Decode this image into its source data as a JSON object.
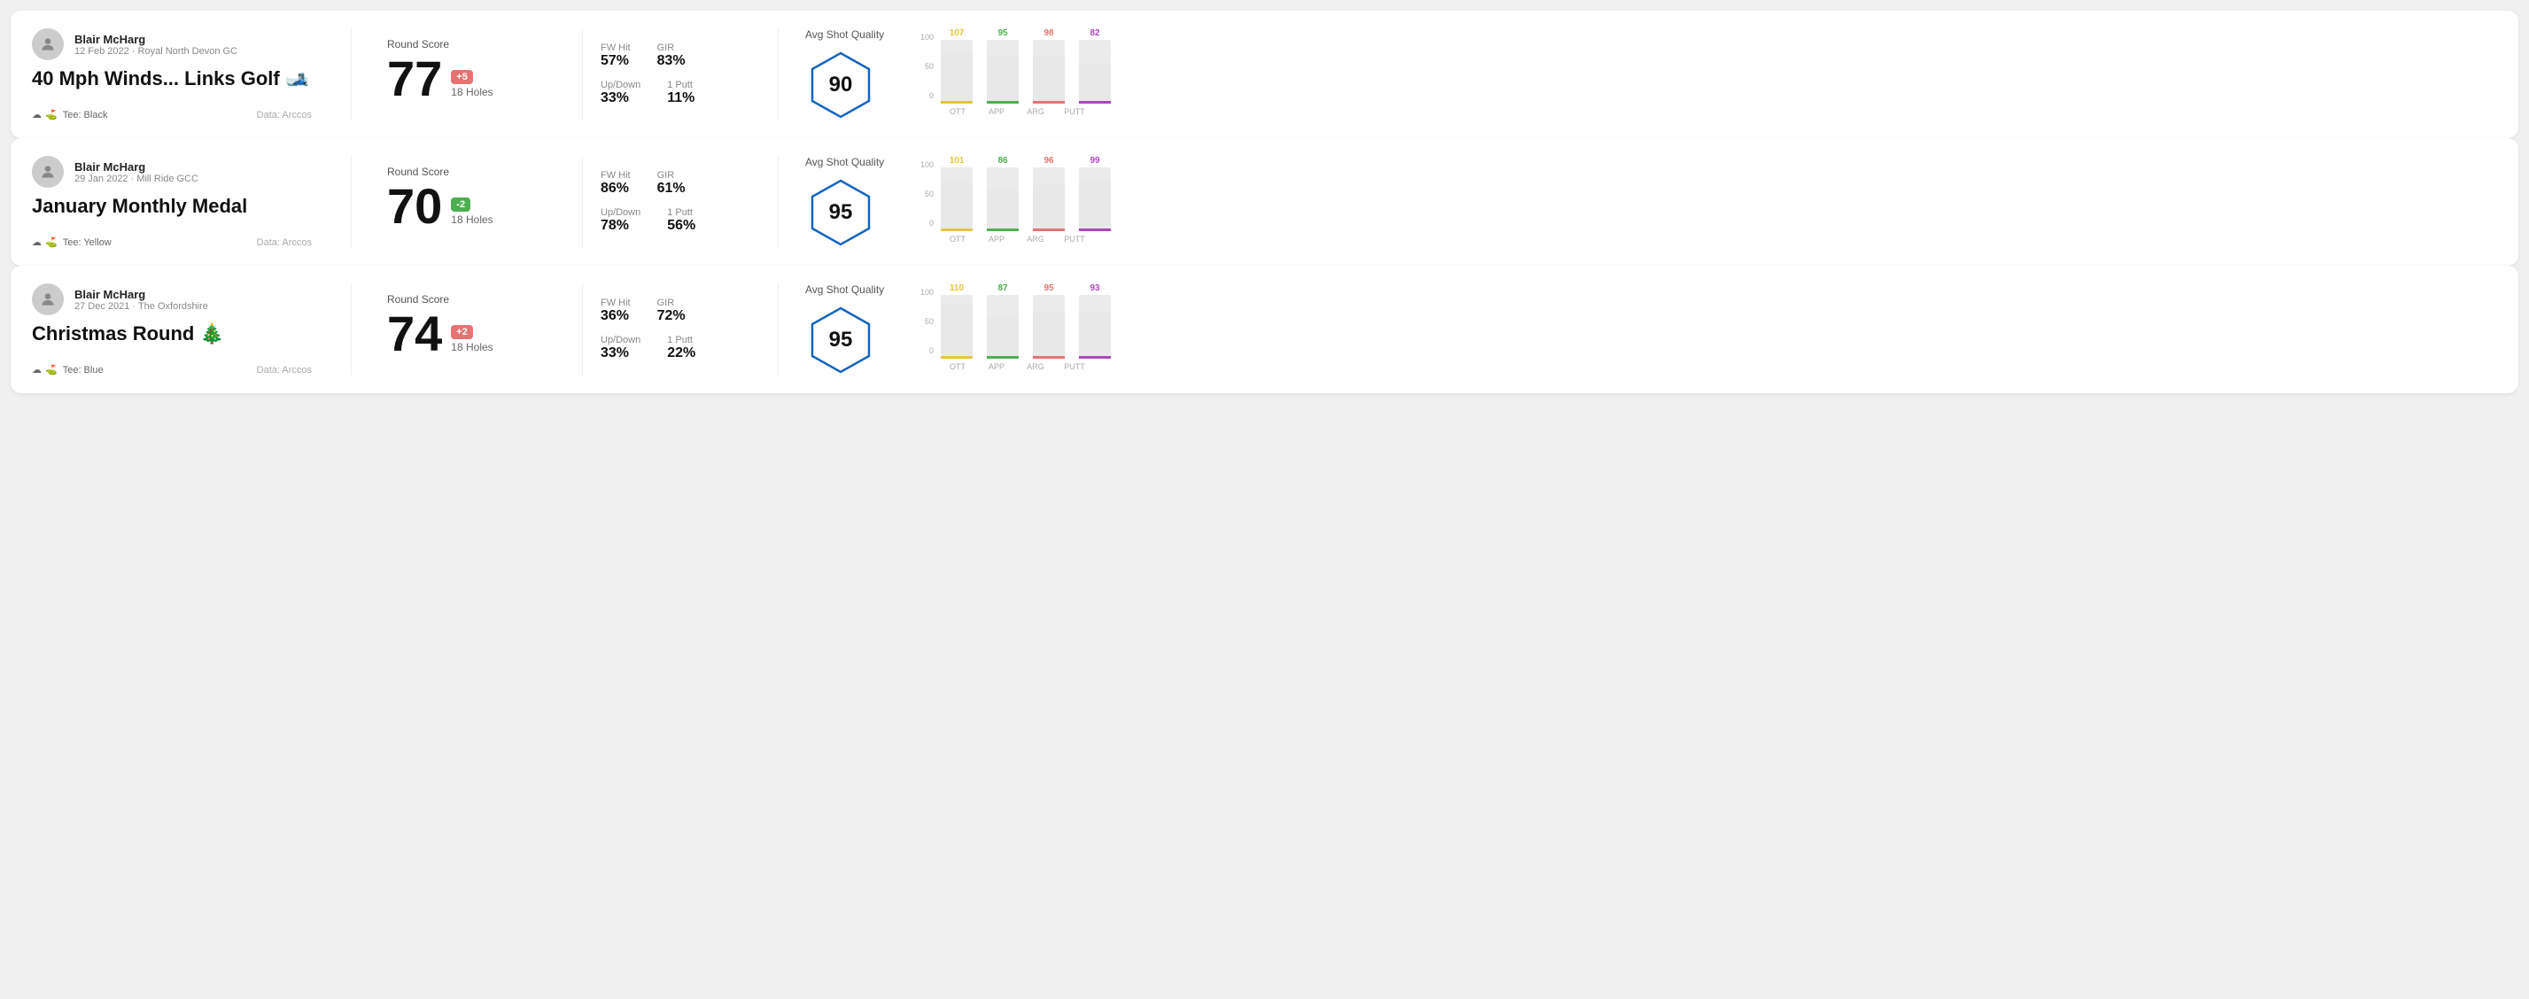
{
  "rounds": [
    {
      "id": "round1",
      "player_name": "Blair McHarg",
      "date_venue": "12 Feb 2022 · Royal North Devon GC",
      "title": "40 Mph Winds... Links Golf 🎿",
      "tee": "Black",
      "data_source": "Data: Arccos",
      "round_score_label": "Round Score",
      "score": "77",
      "badge": "+5",
      "badge_type": "plus",
      "holes": "18 Holes",
      "fw_hit_label": "FW Hit",
      "fw_hit": "57%",
      "gir_label": "GIR",
      "gir": "83%",
      "updown_label": "Up/Down",
      "updown": "33%",
      "oneputt_label": "1 Putt",
      "oneputt": "11%",
      "avg_quality_label": "Avg Shot Quality",
      "quality_score": "90",
      "chart": {
        "bars": [
          {
            "label": "OTT",
            "value": 107,
            "color": "#e6c440"
          },
          {
            "label": "APP",
            "value": 95,
            "color": "#4caf50"
          },
          {
            "label": "ARG",
            "value": 98,
            "color": "#e57373"
          },
          {
            "label": "PUTT",
            "value": 82,
            "color": "#ab47bc"
          }
        ],
        "y_labels": [
          "100",
          "50",
          "0"
        ]
      }
    },
    {
      "id": "round2",
      "player_name": "Blair McHarg",
      "date_venue": "29 Jan 2022 · Mill Ride GCC",
      "title": "January Monthly Medal",
      "tee": "Yellow",
      "data_source": "Data: Arccos",
      "round_score_label": "Round Score",
      "score": "70",
      "badge": "-2",
      "badge_type": "minus",
      "holes": "18 Holes",
      "fw_hit_label": "FW Hit",
      "fw_hit": "86%",
      "gir_label": "GIR",
      "gir": "61%",
      "updown_label": "Up/Down",
      "updown": "78%",
      "oneputt_label": "1 Putt",
      "oneputt": "56%",
      "avg_quality_label": "Avg Shot Quality",
      "quality_score": "95",
      "chart": {
        "bars": [
          {
            "label": "OTT",
            "value": 101,
            "color": "#e6c440"
          },
          {
            "label": "APP",
            "value": 86,
            "color": "#4caf50"
          },
          {
            "label": "ARG",
            "value": 96,
            "color": "#e57373"
          },
          {
            "label": "PUTT",
            "value": 99,
            "color": "#ab47bc"
          }
        ],
        "y_labels": [
          "100",
          "50",
          "0"
        ]
      }
    },
    {
      "id": "round3",
      "player_name": "Blair McHarg",
      "date_venue": "27 Dec 2021 · The Oxfordshire",
      "title": "Christmas Round 🎄",
      "tee": "Blue",
      "data_source": "Data: Arccos",
      "round_score_label": "Round Score",
      "score": "74",
      "badge": "+2",
      "badge_type": "plus",
      "holes": "18 Holes",
      "fw_hit_label": "FW Hit",
      "fw_hit": "36%",
      "gir_label": "GIR",
      "gir": "72%",
      "updown_label": "Up/Down",
      "updown": "33%",
      "oneputt_label": "1 Putt",
      "oneputt": "22%",
      "avg_quality_label": "Avg Shot Quality",
      "quality_score": "95",
      "chart": {
        "bars": [
          {
            "label": "OTT",
            "value": 110,
            "color": "#e6c440"
          },
          {
            "label": "APP",
            "value": 87,
            "color": "#4caf50"
          },
          {
            "label": "ARG",
            "value": 95,
            "color": "#e57373"
          },
          {
            "label": "PUTT",
            "value": 93,
            "color": "#ab47bc"
          }
        ],
        "y_labels": [
          "100",
          "50",
          "0"
        ]
      }
    }
  ]
}
